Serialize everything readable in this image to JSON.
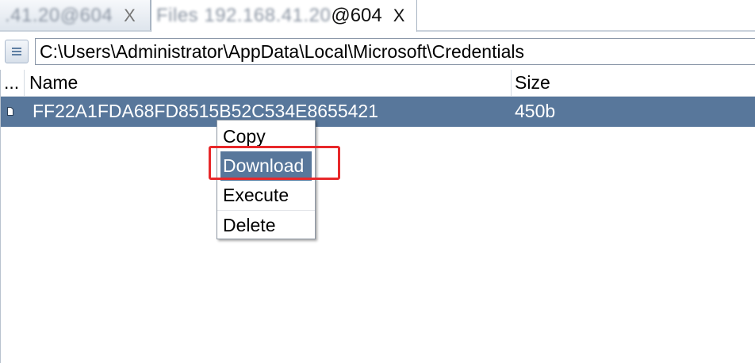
{
  "tabs": [
    {
      "title_blurred": ".41.20@604",
      "close": "X",
      "active": false
    },
    {
      "title_blurred": "Files 192.168.41.20",
      "title_visible": "@604",
      "close": "X",
      "active": true
    }
  ],
  "pathbar": {
    "path": "C:\\Users\\Administrator\\AppData\\Local\\Microsoft\\Credentials",
    "button_icon": "list-menu-icon"
  },
  "filelist": {
    "columns": {
      "dots": "...",
      "name": "Name",
      "size": "Size"
    },
    "rows": [
      {
        "icon": "file-icon",
        "name": "FF22A1FDA68FD8515B52C534E8655421",
        "size": "450b",
        "selected": true
      }
    ]
  },
  "context_menu": {
    "items": [
      {
        "label": "Copy"
      },
      {
        "label": "Download",
        "highlighted": true
      },
      {
        "label": "Execute"
      },
      {
        "label": "Delete"
      }
    ]
  },
  "colors": {
    "selection": "#58779b",
    "annotation": "#e8282a"
  }
}
